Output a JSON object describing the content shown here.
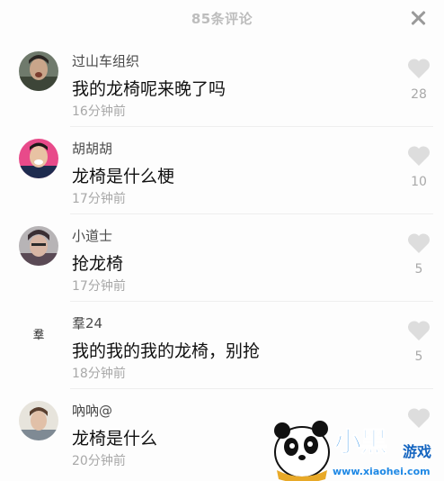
{
  "header": {
    "title": "85条评论",
    "close_icon": "close-icon"
  },
  "comments": [
    {
      "username": "过山车组织",
      "text": "我的龙椅呢来晚了吗",
      "time": "16分钟前",
      "likes": "28",
      "avatar": "photo"
    },
    {
      "username": "胡胡胡",
      "text": "龙椅是什么梗",
      "time": "17分钟前",
      "likes": "10",
      "avatar": "photo"
    },
    {
      "username": "小道士",
      "text": "抢龙椅",
      "time": "17分钟前",
      "likes": "5",
      "avatar": "photo"
    },
    {
      "username": "羣24",
      "text": "我的我的我的龙椅，别抢",
      "time": "18分钟前",
      "likes": "5",
      "avatar_text": "羣"
    },
    {
      "username": "吶吶@",
      "text": "龙椅是什么",
      "time": "20分钟前",
      "likes": "",
      "avatar": "photo"
    }
  ],
  "watermark": {
    "brand": "小黑",
    "brand2": "游戏",
    "url": "www.xiaohei.com"
  },
  "colors": {
    "like_heart": "#dddddd",
    "muted_text": "#a8a8a8",
    "brand_blue": "#1e88e5"
  }
}
